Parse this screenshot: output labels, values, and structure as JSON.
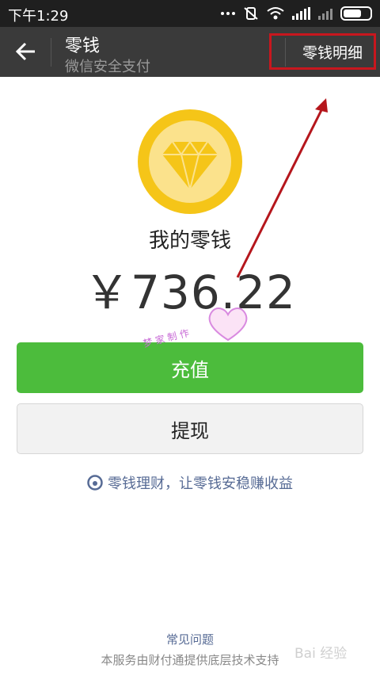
{
  "status_bar": {
    "time": "下午1:29"
  },
  "header": {
    "title": "零钱",
    "subtitle": "微信安全支付",
    "detail_link": "零钱明细"
  },
  "wallet": {
    "label": "我的零钱",
    "balance": "￥736.22"
  },
  "actions": {
    "topup": "充值",
    "withdraw": "提现"
  },
  "promo": {
    "text": "零钱理财，让零钱安稳赚收益"
  },
  "footer": {
    "faq": "常见问题",
    "note": "本服务由财付通提供底层技术支持"
  },
  "overlay": {
    "watermark_text": "梦 家 制 作",
    "baidu": "Bai 经验"
  },
  "colors": {
    "green": "#4cbc3c",
    "header_bg": "#3a3a3a",
    "highlight_red": "#c8171e",
    "link_blue": "#576b95"
  }
}
